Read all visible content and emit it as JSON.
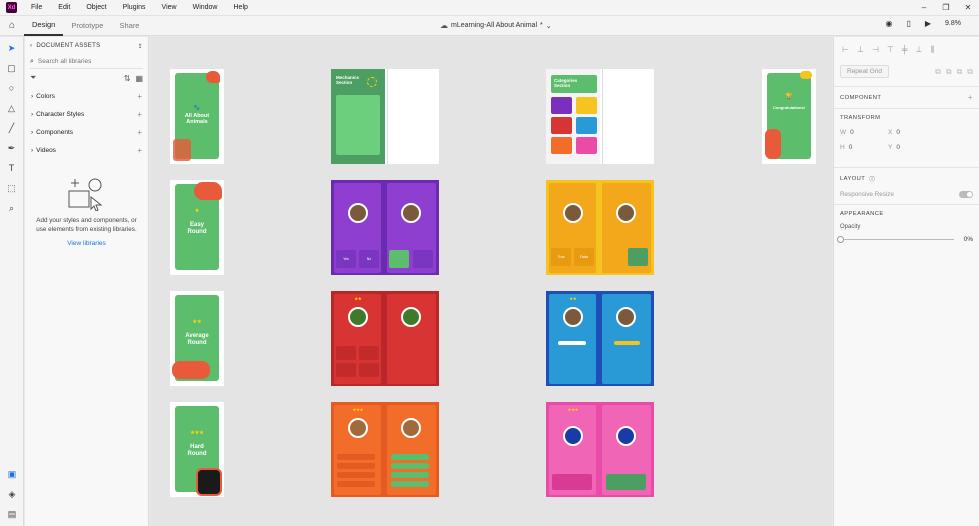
{
  "menu": {
    "app_logo": "Xd",
    "items": [
      "File",
      "Edit",
      "Object",
      "Plugins",
      "View",
      "Window",
      "Help"
    ]
  },
  "toolbar": {
    "tabs": [
      "Design",
      "Prototype",
      "Share"
    ],
    "doc_title": "mLearning-All About Animal",
    "doc_modified": "*",
    "zoom": "9.8%"
  },
  "assets": {
    "header": "DOCUMENT ASSETS",
    "search_placeholder": "Search all libraries",
    "sections": [
      "Colors",
      "Character Styles",
      "Components",
      "Videos"
    ],
    "empty_text": "Add your styles and components, or use elements from existing libraries.",
    "link": "View libraries"
  },
  "canvas": {
    "intro_title": "All About Animals",
    "easy": "Easy Round",
    "average": "Average Round",
    "hard": "Hard Round",
    "mechanics": "Mechanics Section",
    "categories": "Categories Section",
    "congrats": "Congratulations!",
    "yes": "Yes",
    "no": "No",
    "true": "True",
    "false": "False"
  },
  "props": {
    "repeat_grid": "Repeat Grid",
    "component": "COMPONENT",
    "transform": "TRANSFORM",
    "w_label": "W",
    "w_val": "0",
    "x_label": "X",
    "x_val": "0",
    "h_label": "H",
    "h_val": "0",
    "y_label": "Y",
    "y_val": "0",
    "layout": "LAYOUT",
    "responsive_resize": "Responsive Resize",
    "appearance": "APPEARANCE",
    "opacity": "Opacity",
    "opacity_val": "0%"
  },
  "colors": {
    "green": "#5cbd6c",
    "purple": "#7b2fbf",
    "red": "#d93434",
    "orange": "#f26c2a",
    "yellow": "#f7c31f",
    "blue": "#2a6ad6",
    "pink": "#e94ba6",
    "accent": "#1473e6"
  }
}
